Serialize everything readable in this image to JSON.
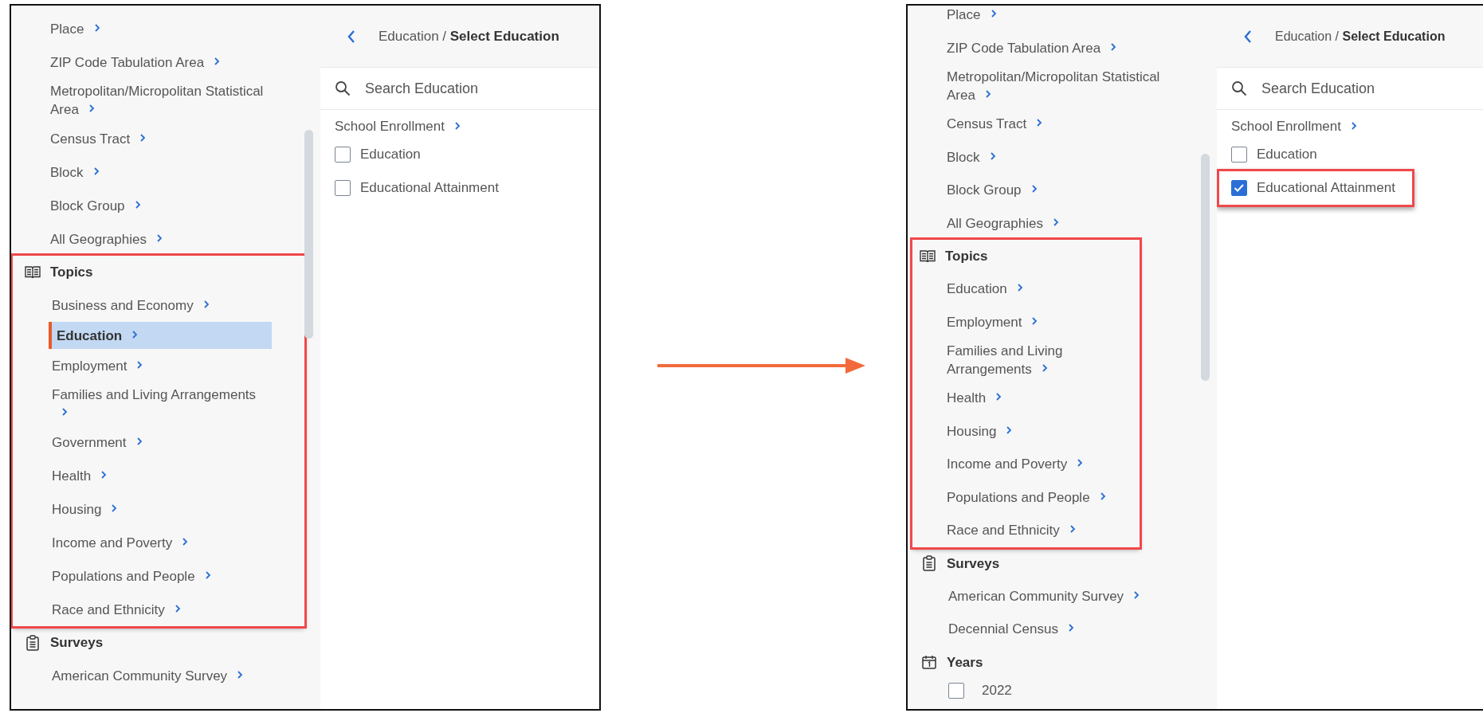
{
  "panels": [
    {
      "sidebar": {
        "items": [
          {
            "label": "Place",
            "selected": false
          },
          {
            "label": "ZIP Code Tabulation Area",
            "selected": false
          },
          {
            "label": "Metropolitan/Micropolitan Statistical Area",
            "selected": false
          },
          {
            "label": "Census Tract",
            "selected": false
          },
          {
            "label": "Block",
            "selected": false
          },
          {
            "label": "Block Group",
            "selected": false
          },
          {
            "label": "All Geographies",
            "selected": false
          }
        ],
        "sections": [
          {
            "kind": "topics",
            "title": "Topics",
            "highlighted": true,
            "items": [
              {
                "label": "Business and Economy",
                "selected": false
              },
              {
                "label": "Education",
                "selected": true
              },
              {
                "label": "Employment",
                "selected": false
              },
              {
                "label": "Families and Living Arrangements",
                "selected": false
              },
              {
                "label": "Government",
                "selected": false
              },
              {
                "label": "Health",
                "selected": false
              },
              {
                "label": "Housing",
                "selected": false
              },
              {
                "label": "Income and Poverty",
                "selected": false
              },
              {
                "label": "Populations and People",
                "selected": false
              },
              {
                "label": "Race and Ethnicity",
                "selected": false
              }
            ]
          },
          {
            "kind": "surveys",
            "title": "Surveys",
            "highlighted": false,
            "items": [
              {
                "label": "American Community Survey",
                "selected": false
              }
            ]
          }
        ]
      },
      "breadcrumb": "Education / **Select Education**",
      "search": {
        "placeholder": "Search Education"
      },
      "links": [
        "School Enrollment"
      ],
      "options": [
        {
          "label": "Education",
          "checked": false,
          "highlighted": false
        },
        {
          "label": "Educational Attainment",
          "checked": false,
          "highlighted": false
        }
      ]
    },
    {
      "sidebar": {
        "items": [
          {
            "label": "Place",
            "selected": false
          },
          {
            "label": "ZIP Code Tabulation Area",
            "selected": false
          },
          {
            "label": "Metropolitan/Micropolitan Statistical Area",
            "selected": false
          },
          {
            "label": "Census Tract",
            "selected": false
          },
          {
            "label": "Block",
            "selected": false
          },
          {
            "label": "Block Group",
            "selected": false
          },
          {
            "label": "All Geographies",
            "selected": false
          }
        ],
        "sections": [
          {
            "kind": "topics",
            "title": "Topics",
            "highlighted": true,
            "items": [
              {
                "label": "Education",
                "selected": false
              },
              {
                "label": "Employment",
                "selected": false
              },
              {
                "label": "Families and Living Arrangements",
                "selected": false
              },
              {
                "label": "Health",
                "selected": false
              },
              {
                "label": "Housing",
                "selected": false
              },
              {
                "label": "Income and Poverty",
                "selected": false
              },
              {
                "label": "Populations and People",
                "selected": false
              },
              {
                "label": "Race and Ethnicity",
                "selected": false
              }
            ]
          },
          {
            "kind": "surveys",
            "title": "Surveys",
            "highlighted": false,
            "items": [
              {
                "label": "American Community Survey",
                "selected": false
              },
              {
                "label": "Decennial Census",
                "selected": false
              }
            ]
          },
          {
            "kind": "years",
            "title": "Years",
            "highlighted": false,
            "items": [
              {
                "label": "2022",
                "checked": false
              }
            ]
          }
        ]
      },
      "breadcrumb": "Education / **Select Education**",
      "search": {
        "placeholder": "Search Education"
      },
      "links": [
        "School Enrollment"
      ],
      "options": [
        {
          "label": "Education",
          "checked": false,
          "highlighted": false
        },
        {
          "label": "Educational Attainment",
          "checked": true,
          "highlighted": true
        }
      ]
    }
  ]
}
